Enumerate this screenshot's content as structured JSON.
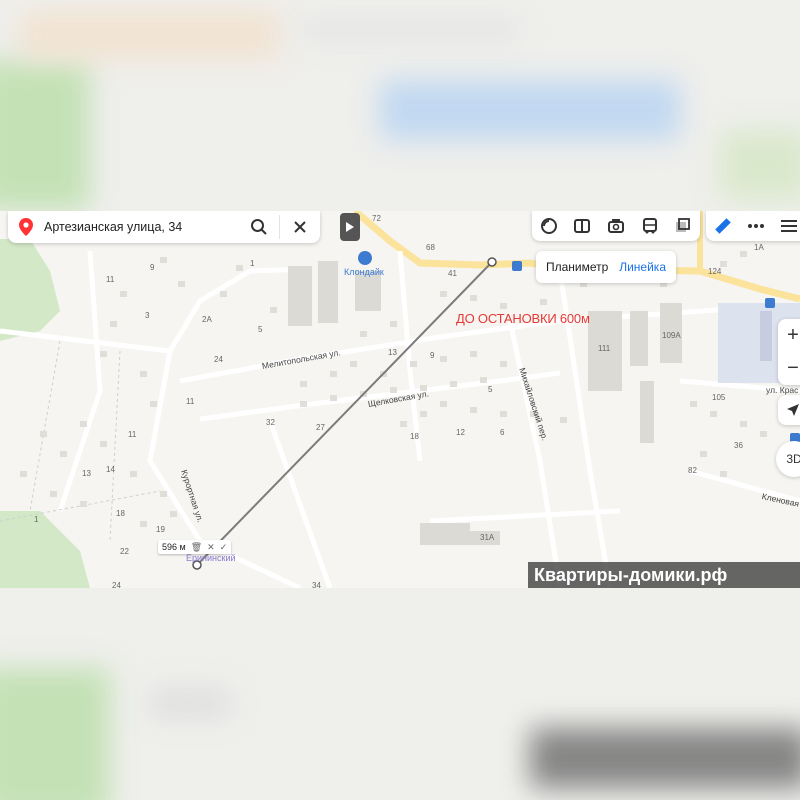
{
  "search": {
    "value": "Артезианская улица, 34",
    "pin_icon": "location-pin-icon",
    "search_icon": "search-icon",
    "close_icon": "close-icon"
  },
  "toolbar": {
    "tools": [
      "layers-icon",
      "panorama-icon",
      "camera-icon",
      "bus-icon",
      "layers-stack-icon"
    ],
    "extra_tools": [
      "ruler-icon",
      "more-icon",
      "menu-icon"
    ]
  },
  "ruler_popup": {
    "options": [
      "Планиметр",
      "Линейка"
    ],
    "active": "Линейка"
  },
  "zoom": {
    "in": "+",
    "out": "−"
  },
  "btn3d": "3D",
  "measurement": {
    "distance": "596 м"
  },
  "annotation": "ДО ОСТАНОВКИ 600м",
  "watermark": "Квартиры-домики.рф",
  "streets": [
    "Мелитопольская ул.",
    "Щелковская ул.",
    "Михайловский пер.",
    "Курортная ул.",
    "ул. Крас",
    "Кленовая"
  ],
  "places": {
    "poi": "Клондайк",
    "district": "Ерининский"
  },
  "house_numbers": [
    "72",
    "68",
    "9",
    "11",
    "1",
    "3",
    "2А",
    "5",
    "24",
    "11",
    "13",
    "9",
    "41",
    "111",
    "109А",
    "124",
    "1А",
    "105",
    "36",
    "82",
    "13",
    "14",
    "11",
    "18",
    "19",
    "22",
    "1",
    "24",
    "32",
    "27",
    "18",
    "12",
    "6",
    "5",
    "31А",
    "34"
  ],
  "colors": {
    "accent": "#1a73e8",
    "annotation": "#e53935",
    "road_main": "#fbe39c",
    "building": "#d9d7d2"
  }
}
